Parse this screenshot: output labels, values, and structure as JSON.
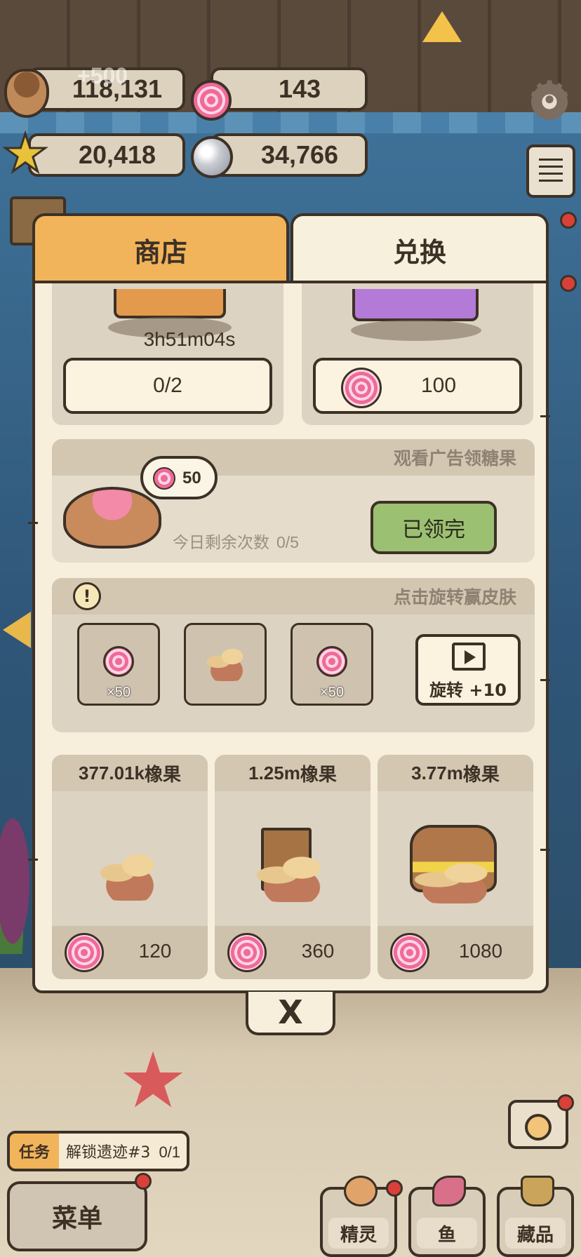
{
  "resources": {
    "acorns": "118,131",
    "candy": "143",
    "stars": "20,418",
    "pearls": "34,766",
    "acorn_gain": "+500"
  },
  "tabs": {
    "shop": "商店",
    "exchange": "兑换"
  },
  "chests": {
    "wood": {
      "timer": "3h51m04s",
      "button": "0/2"
    },
    "purple": {
      "price": "100"
    }
  },
  "ad_candy": {
    "title": "观看广告领糖果",
    "bubble_amount": "50",
    "remaining_label": "今日剩余次数",
    "remaining_value": "0/5",
    "button": "已领完"
  },
  "spin": {
    "title": "点击旋转赢皮肤",
    "warning_symbol": "!",
    "slots": [
      {
        "item": "candy",
        "qty": "×50"
      },
      {
        "item": "acorn-pile",
        "qty": ""
      },
      {
        "item": "candy",
        "qty": "×50"
      }
    ],
    "button": "旋转 +10"
  },
  "offers": [
    {
      "amount": "377.01k",
      "unit": "橡果",
      "price": "120"
    },
    {
      "amount": "1.25m",
      "unit": "橡果",
      "price": "360"
    },
    {
      "amount": "3.77m",
      "unit": "橡果",
      "price": "1080"
    }
  ],
  "close_symbol": "X",
  "quest": {
    "tag": "任务",
    "text": "解锁遗迹#3",
    "progress": "0/1"
  },
  "bottom_nav": {
    "menu": "菜单",
    "sprite": "精灵",
    "fish": "鱼",
    "collection": "藏品"
  },
  "colors": {
    "outline": "#3d3126",
    "tab_active": "#f2b45a",
    "claimed_button": "#9cc071",
    "candy_pink": "#f06a9a",
    "panel_bg": "#f7efdc"
  }
}
